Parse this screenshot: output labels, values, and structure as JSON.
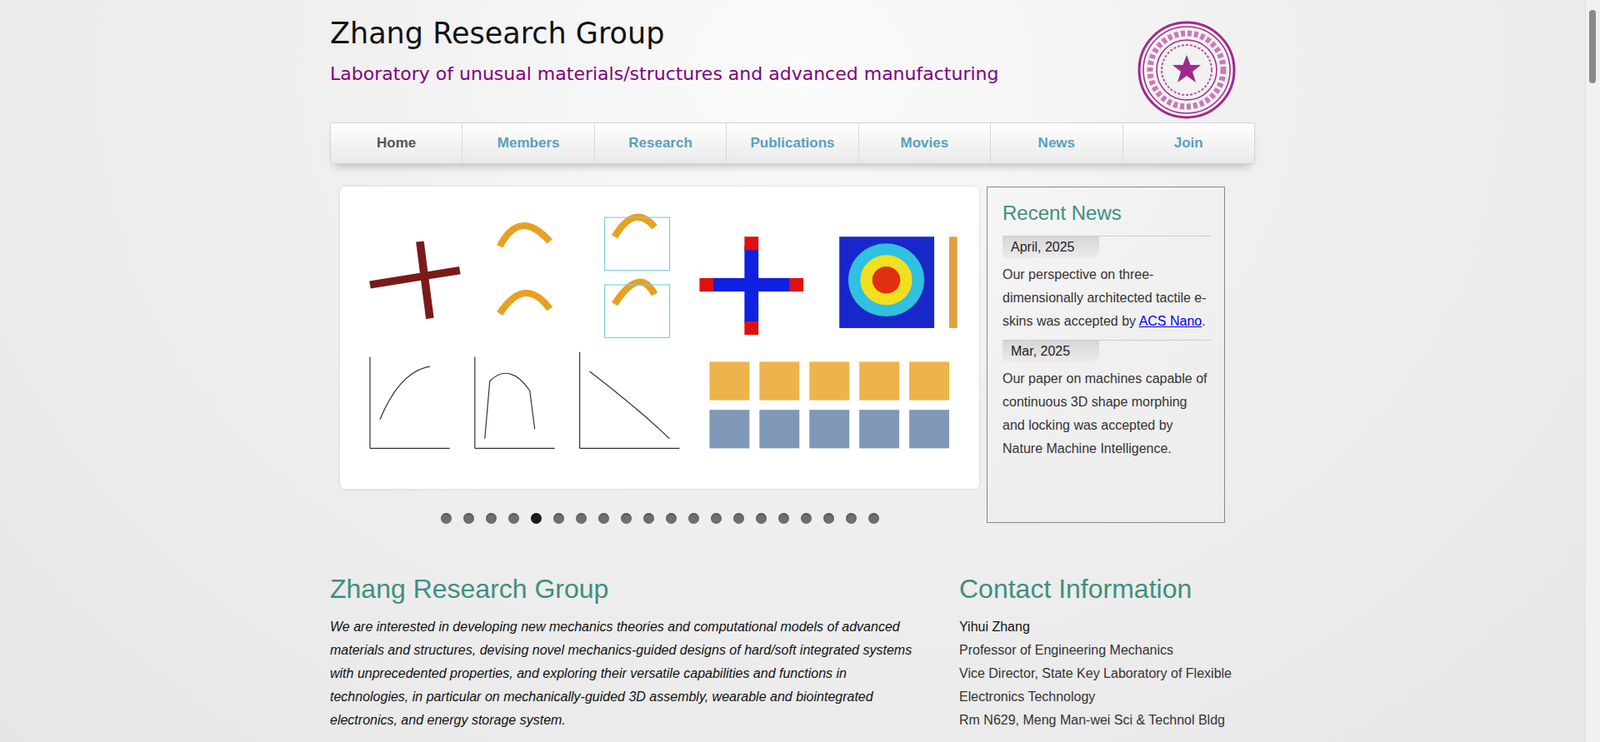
{
  "header": {
    "title": "Zhang Research Group",
    "subtitle": "Laboratory of unusual materials/structures and advanced manufacturing"
  },
  "nav": [
    {
      "label": "Home",
      "selected": true
    },
    {
      "label": "Members",
      "selected": false
    },
    {
      "label": "Research",
      "selected": false
    },
    {
      "label": "Publications",
      "selected": false
    },
    {
      "label": "Movies",
      "selected": false
    },
    {
      "label": "News",
      "selected": false
    },
    {
      "label": "Join",
      "selected": false
    }
  ],
  "slideshow": {
    "dots": [
      {
        "selected": false
      },
      {
        "selected": false
      },
      {
        "selected": false
      },
      {
        "selected": false
      },
      {
        "selected": true
      },
      {
        "selected": false
      },
      {
        "selected": false
      },
      {
        "selected": false
      },
      {
        "selected": false
      },
      {
        "selected": false
      },
      {
        "selected": false
      },
      {
        "selected": false
      },
      {
        "selected": false
      },
      {
        "selected": false
      },
      {
        "selected": false
      },
      {
        "selected": false
      },
      {
        "selected": false
      },
      {
        "selected": false
      },
      {
        "selected": false
      },
      {
        "selected": false
      }
    ]
  },
  "news": {
    "title": "Recent News",
    "items": [
      {
        "date": "April, 2025",
        "parts": [
          {
            "text": "Our perspective on three-dimensionally architected tactile e-skins was accepted by ",
            "link": false
          },
          {
            "text": "ACS Nano",
            "link": true
          },
          {
            "text": ".",
            "link": false
          }
        ]
      },
      {
        "date": "Mar, 2025",
        "parts": [
          {
            "text": "Our paper on machines capable of continuous 3D shape morphing and locking was accepted by Nature Machine Intelligence.",
            "link": false
          }
        ]
      }
    ]
  },
  "about": {
    "title": "Zhang Research Group",
    "text": "We are interested in developing new mechanics theories and computational models of advanced materials and structures, devising novel mechanics-guided designs of hard/soft integrated systems with unprecedented properties, and exploring their versatile capabilities and functions in technologies, in particular on mechanically-guided 3D assembly, wearable and biointegrated electronics, and energy storage system."
  },
  "contact": {
    "title": "Contact Information",
    "name": "Yihui Zhang",
    "lines": [
      "Professor of Engineering Mechanics",
      "Vice Director, State Key Laboratory of Flexible Electronics Technology",
      "Rm N629, Meng Man-wei Sci & Technol Bldg"
    ]
  }
}
